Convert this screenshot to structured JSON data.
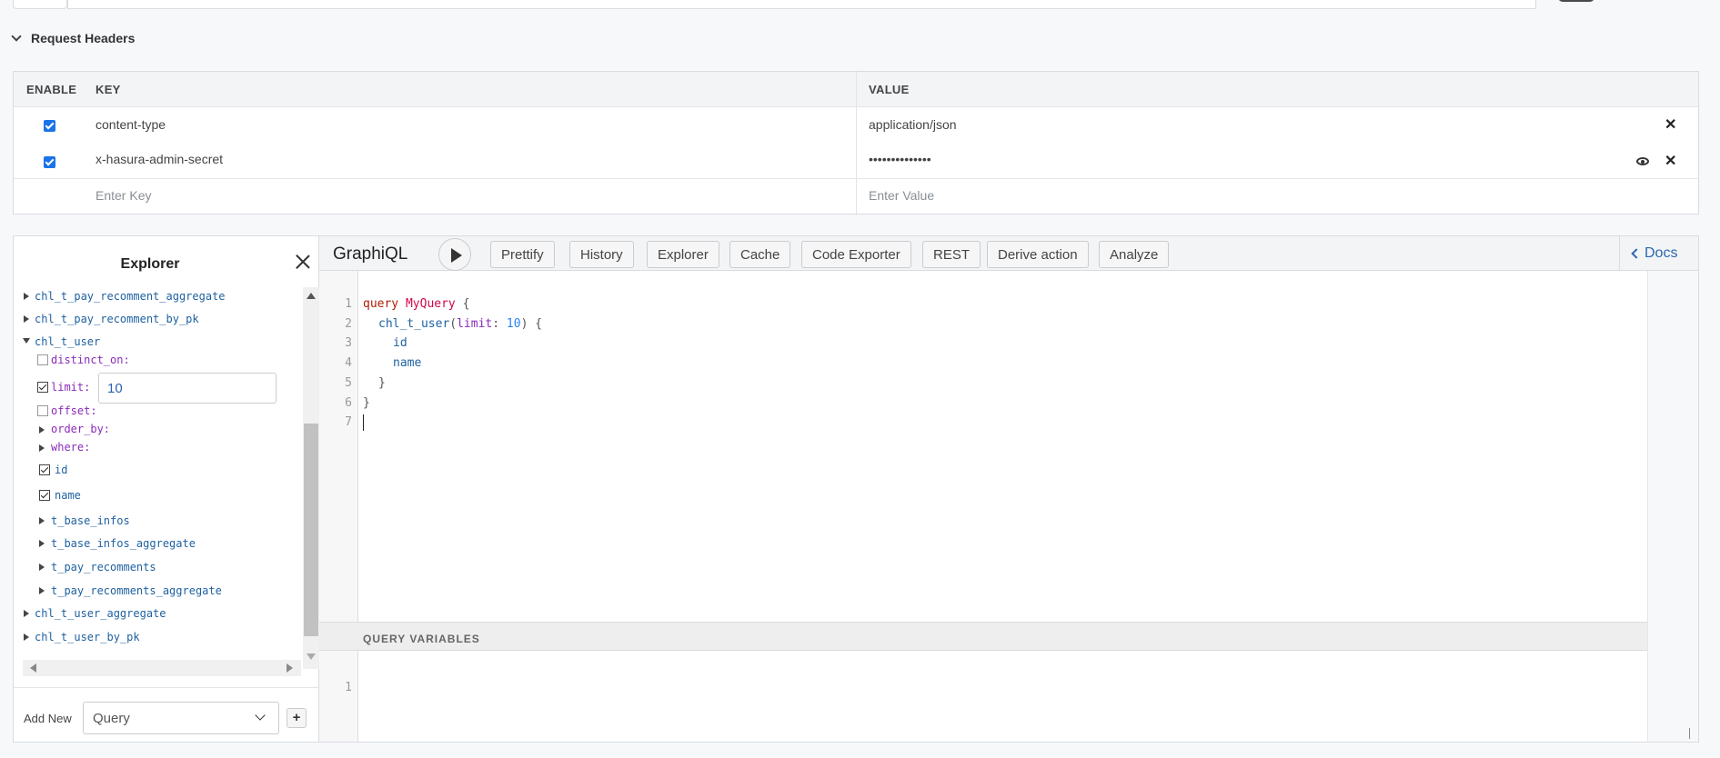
{
  "request_headers": {
    "title": "Request Headers",
    "columns": {
      "enable": "ENABLE",
      "key": "KEY",
      "value": "VALUE"
    },
    "rows": [
      {
        "enabled": true,
        "key": "content-type",
        "value": "application/json"
      },
      {
        "enabled": true,
        "key": "x-hasura-admin-secret",
        "value": "••••••••••••••"
      }
    ],
    "new_row": {
      "key_placeholder": "Enter Key",
      "value_placeholder": "Enter Value"
    }
  },
  "explorer": {
    "title": "Explorer",
    "tree": {
      "item0": "chl_t_pay_recomment_aggregate",
      "item1": "chl_t_pay_recomment_by_pk",
      "item2": "chl_t_user",
      "arg_distinct_on": "distinct_on:",
      "arg_limit": "limit:",
      "limit_value": "10",
      "arg_offset": "offset:",
      "arg_order_by": "order_by:",
      "arg_where": "where:",
      "field_id": "id",
      "field_name": "name",
      "sub0": "t_base_infos",
      "sub1": "t_base_infos_aggregate",
      "sub2": "t_pay_recomments",
      "sub3": "t_pay_recomments_aggregate",
      "item3": "chl_t_user_aggregate",
      "item4": "chl_t_user_by_pk"
    },
    "footer": {
      "add_new_label": "Add New",
      "operation_selected": "Query",
      "plus_label": "+"
    }
  },
  "graphiql": {
    "title": "GraphiQL",
    "buttons": {
      "prettify": "Prettify",
      "history": "History",
      "explorer": "Explorer",
      "cache": "Cache",
      "code_exporter": "Code Exporter",
      "rest": "REST",
      "derive_action": "Derive action",
      "analyze": "Analyze"
    },
    "docs_label": "Docs",
    "line_numbers": [
      "1",
      "2",
      "3",
      "4",
      "5",
      "6",
      "7"
    ],
    "query": {
      "kw_query": "query",
      "op_name": "MyQuery",
      "open_brace": " {",
      "root_field": "chl_t_user",
      "arg_name": "limit",
      "arg_value": "10",
      "line2_close": ") {",
      "field1": "id",
      "field2": "name",
      "inner_close": "}",
      "outer_close": "}"
    },
    "query_variables": {
      "title": "QUERY VARIABLES",
      "line_number": "1"
    }
  }
}
